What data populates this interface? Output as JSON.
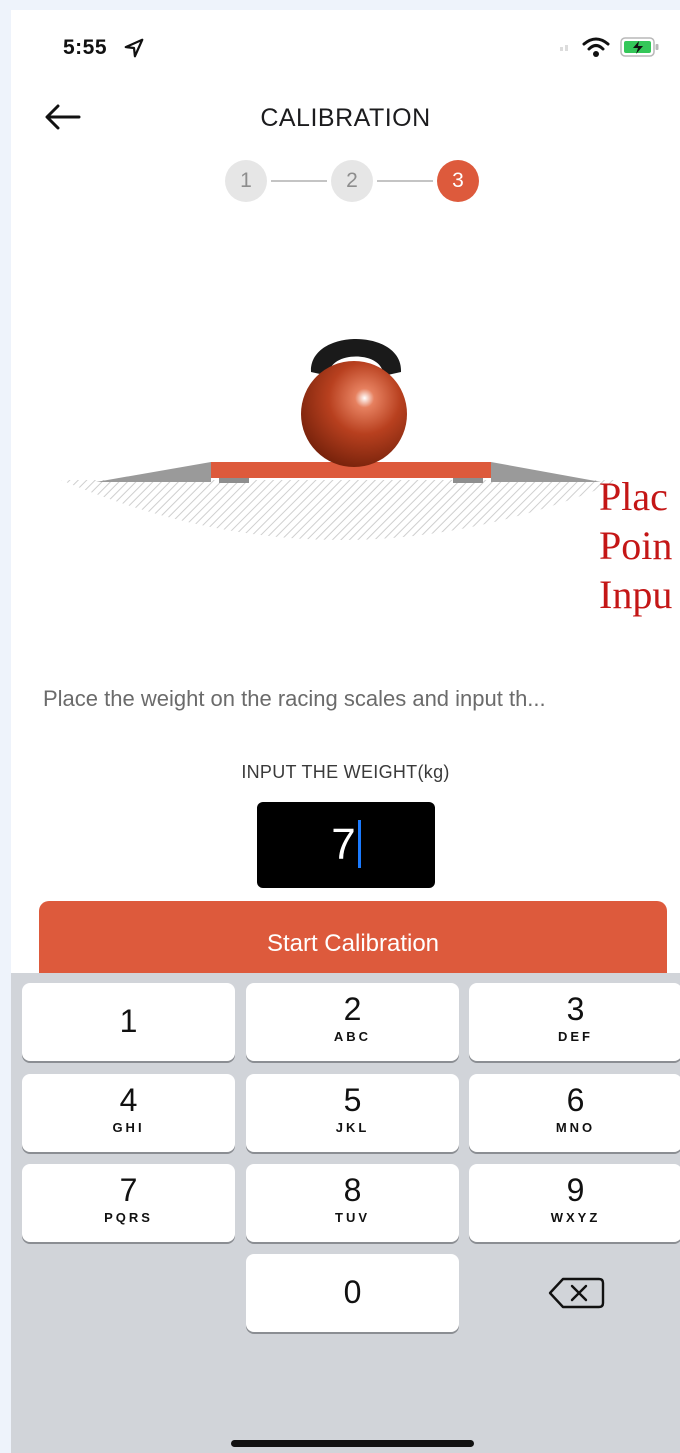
{
  "status_bar": {
    "time": "5:55"
  },
  "nav": {
    "title": "CALIBRATION"
  },
  "stepper": {
    "steps": [
      "1",
      "2",
      "3"
    ],
    "active_step": 3
  },
  "overlay_text": [
    "Plac",
    "Poin",
    "Inpu"
  ],
  "instruction": "Place the weight on the racing scales and input th...",
  "weight": {
    "label": "INPUT THE WEIGHT(kg)",
    "value": "7"
  },
  "start_button": {
    "label": "Start Calibration"
  },
  "keypad": {
    "keys": [
      {
        "num": "1",
        "letters": ""
      },
      {
        "num": "2",
        "letters": "ABC"
      },
      {
        "num": "3",
        "letters": "DEF"
      },
      {
        "num": "4",
        "letters": "GHI"
      },
      {
        "num": "5",
        "letters": "JKL"
      },
      {
        "num": "6",
        "letters": "MNO"
      },
      {
        "num": "7",
        "letters": "PQRS"
      },
      {
        "num": "8",
        "letters": "TUV"
      },
      {
        "num": "9",
        "letters": "WXYZ"
      },
      {
        "num": "0",
        "letters": ""
      }
    ]
  },
  "colors": {
    "accent": "#dd5a3c",
    "input_bg": "#000000",
    "keyboard_bg": "#d1d4d9",
    "overlay_text": "#c41616",
    "caret": "#1b7bff"
  }
}
